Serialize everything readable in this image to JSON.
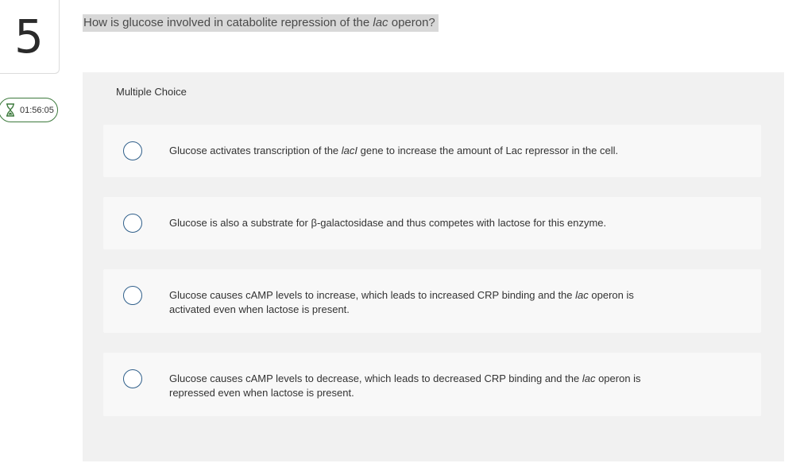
{
  "question_number": "5",
  "timer": "01:56:05",
  "question": {
    "before": "How is glucose involved in catabolite repression of the ",
    "italic": "lac",
    "after": " operon?"
  },
  "answer_type": "Multiple Choice",
  "options": [
    {
      "before": "Glucose activates transcription of the ",
      "italic": "lacI",
      "after": " gene to increase the amount of Lac repressor in the cell."
    },
    {
      "before": "Glucose is also a substrate for β-galactosidase and thus competes with lactose for this enzyme.",
      "italic": "",
      "after": ""
    },
    {
      "before": "Glucose causes cAMP levels to increase, which leads to increased CRP binding and the ",
      "italic": "lac",
      "after": " operon is activated even when lactose is present."
    },
    {
      "before": "Glucose causes cAMP levels to decrease, which leads to decreased CRP binding and the ",
      "italic": "lac",
      "after": " operon is repressed even when lactose is present."
    }
  ],
  "icons": {
    "timer_icon": "hourglass-icon"
  },
  "colors": {
    "timer_border": "#3d7a3d",
    "radio_border": "#2f5f8a",
    "question_highlight": "#d8d8d8"
  }
}
